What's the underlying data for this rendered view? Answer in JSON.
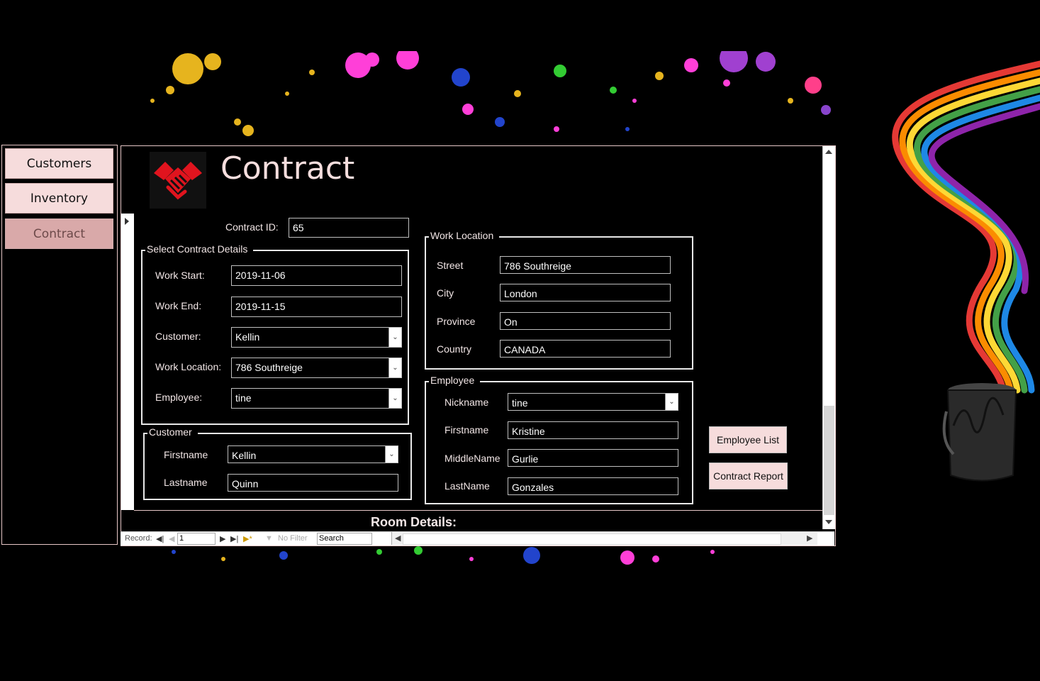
{
  "nav": {
    "items": [
      {
        "label": "Customers",
        "active": false
      },
      {
        "label": "Inventory",
        "active": false
      },
      {
        "label": "Contract",
        "active": true
      }
    ]
  },
  "form": {
    "title": "Contract",
    "logo_icon": "handshake-icon",
    "contract_id": {
      "label": "Contract ID:",
      "value": "65"
    },
    "details": {
      "title": "Select Contract Details",
      "work_start": {
        "label": "Work Start:",
        "value": "2019-11-06"
      },
      "work_end": {
        "label": "Work End:",
        "value": "2019-11-15"
      },
      "customer": {
        "label": "Customer:",
        "value": "Kellin"
      },
      "work_location": {
        "label": "Work Location:",
        "value": "786 Southreige"
      },
      "employee": {
        "label": "Employee:",
        "value": "tine"
      }
    },
    "customer": {
      "title": "Customer",
      "firstname": {
        "label": "Firstname",
        "value": "Kellin"
      },
      "lastname": {
        "label": "Lastname",
        "value": "Quinn"
      }
    },
    "work_location": {
      "title": "Work Location",
      "street": {
        "label": "Street",
        "value": "786 Southreige"
      },
      "city": {
        "label": "City",
        "value": "London"
      },
      "province": {
        "label": "Province",
        "value": "On"
      },
      "country": {
        "label": "Country",
        "value": "CANADA"
      }
    },
    "employee": {
      "title": "Employee",
      "nickname": {
        "label": "Nickname",
        "value": "tine"
      },
      "firstname": {
        "label": "Firstname",
        "value": "Kristine"
      },
      "middlename": {
        "label": "MiddleName",
        "value": "Gurlie"
      },
      "lastname": {
        "label": "LastName",
        "value": "Gonzales"
      }
    },
    "buttons": {
      "employee_list": "Employee List",
      "contract_report": "Contract Report"
    },
    "room_details": "Room Details:"
  },
  "record_nav": {
    "record_label": "Record:",
    "record_value": "1",
    "filter_label": "No Filter",
    "search_placeholder": "Search"
  },
  "colors": {
    "background": "#000000",
    "nav_button": "#f6dcdc",
    "nav_button_active": "#d9a9a9",
    "logo_red": "#e0141e"
  }
}
